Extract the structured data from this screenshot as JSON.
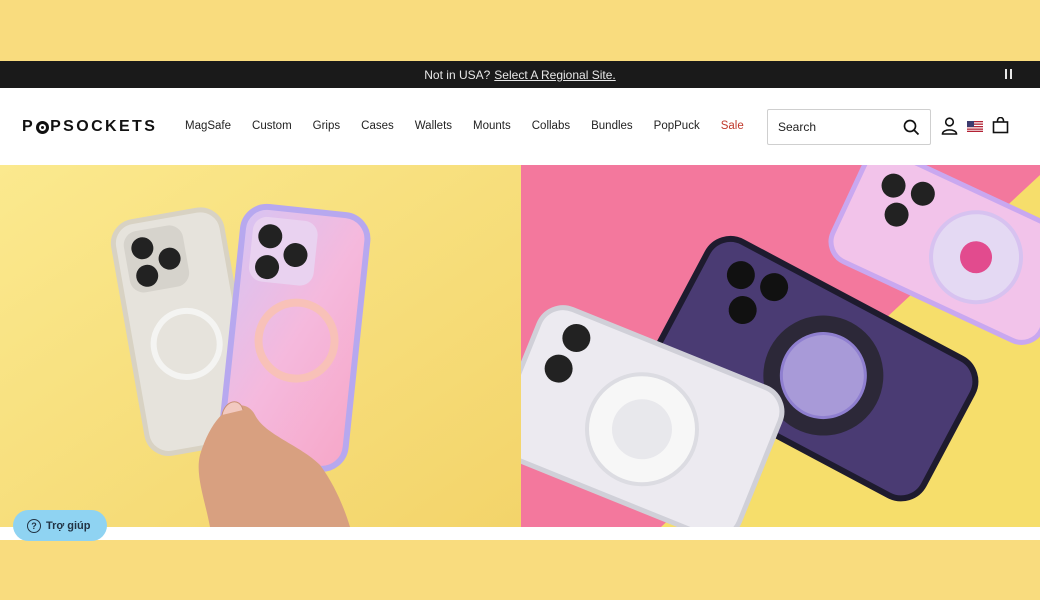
{
  "announcement": {
    "text": "Not in USA?",
    "link": "Select A Regional Site."
  },
  "brand": {
    "logo_pre": "P",
    "logo_post": "PSOCKETS"
  },
  "nav": {
    "items": [
      "MagSafe",
      "Custom",
      "Grips",
      "Cases",
      "Wallets",
      "Mounts",
      "Collabs",
      "Bundles",
      "PopPuck",
      "Sale"
    ]
  },
  "search": {
    "placeholder": "Search"
  },
  "icons": [
    "search-icon",
    "account-icon",
    "us-flag-icon",
    "cart-icon",
    "pause-icon",
    "help-icon"
  ],
  "help": {
    "label": "Trợ giúp"
  },
  "colors": {
    "page_bg": "#f9dc7e",
    "announce_bg": "#1a1a1a",
    "sale": "#c0392b",
    "help_bg": "#8fd3f2",
    "hero_right_bg": "#f3789d"
  }
}
